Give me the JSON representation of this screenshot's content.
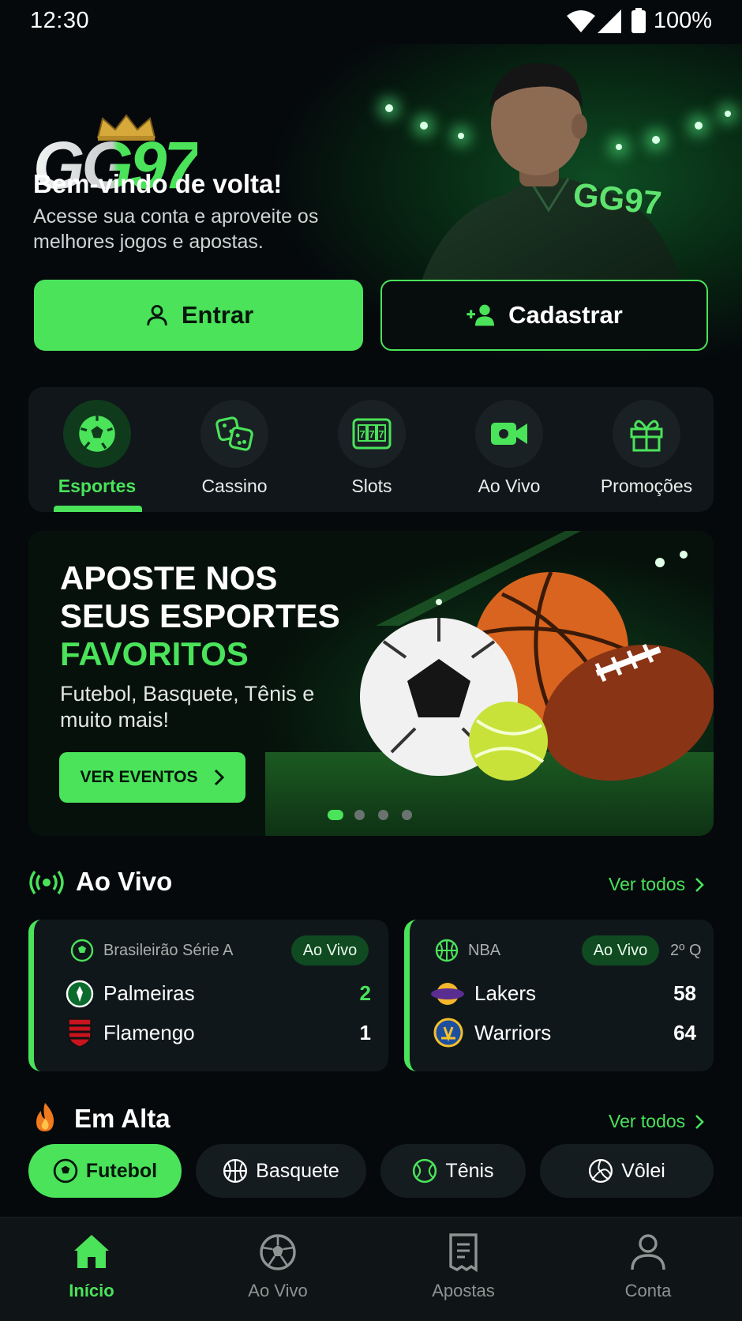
{
  "status_bar": {
    "time": "12:30",
    "battery": "100%"
  },
  "hero": {
    "logo_text": "GG97",
    "welcome": "Bem-vindo de volta!",
    "subtitle": "Acesse sua conta e aproveite os melhores jogos e apostas.",
    "jersey_text": "GG97",
    "login_label": "Entrar",
    "register_label": "Cadastrar"
  },
  "categories": [
    {
      "label": "Esportes",
      "icon": "soccer-ball-icon",
      "active": true
    },
    {
      "label": "Cassino",
      "icon": "dice-icon"
    },
    {
      "label": "Slots",
      "icon": "slot-machine-icon"
    },
    {
      "label": "Ao Vivo",
      "icon": "video-camera-icon"
    },
    {
      "label": "Promoções",
      "icon": "gift-icon"
    }
  ],
  "banner": {
    "title_line1": "APOSTE NOS",
    "title_line2": "SEUS ESPORTES",
    "title_line3": "FAVORITOS",
    "subtitle": "Futebol, Basquete, Tênis e muito mais!",
    "cta": "VER EVENTOS",
    "slides": 4,
    "active_slide": 1
  },
  "live": {
    "title": "Ao Vivo",
    "see_all": "Ver todos",
    "matches": [
      {
        "league": "Brasileirão Série A",
        "badge": "Ao Vivo",
        "period": "",
        "home": {
          "name": "Palmeiras",
          "score": "2"
        },
        "away": {
          "name": "Flamengo",
          "score": "1"
        }
      },
      {
        "league": "NBA",
        "badge": "Ao Vivo",
        "period": "2º Q",
        "home": {
          "name": "Lakers",
          "score": "58"
        },
        "away": {
          "name": "Warriors",
          "score": "64"
        }
      }
    ]
  },
  "trending": {
    "title": "Em Alta",
    "see_all": "Ver todos",
    "chips": [
      {
        "label": "Futebol",
        "active": true
      },
      {
        "label": "Basquete"
      },
      {
        "label": "Tênis"
      },
      {
        "label": "Vôlei"
      }
    ]
  },
  "nav": [
    {
      "label": "Início",
      "active": true
    },
    {
      "label": "Ao Vivo"
    },
    {
      "label": "Apostas"
    },
    {
      "label": "Conta"
    }
  ],
  "colors": {
    "accent": "#4ae35a",
    "background": "#05090c",
    "card": "#10171a"
  }
}
